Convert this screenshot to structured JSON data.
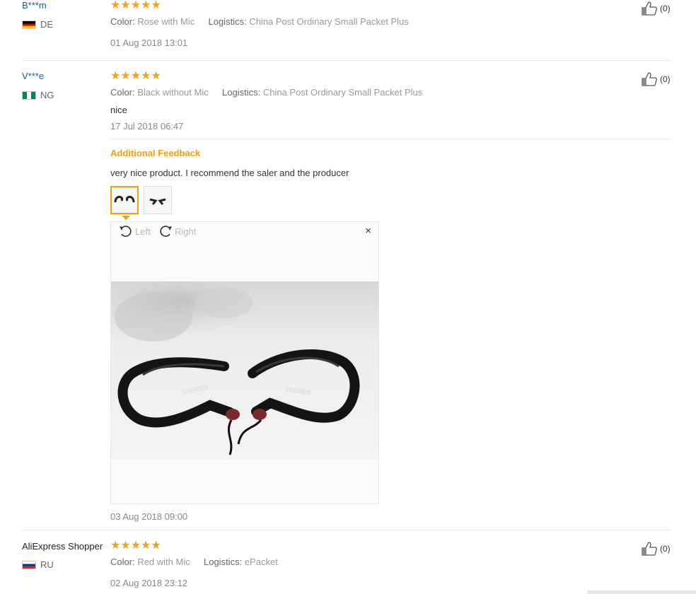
{
  "reviews": [
    {
      "user": "B***m",
      "country": "DE",
      "stars": "★★★★★",
      "color_label": "Color:",
      "color_value": "Rose with Mic",
      "logistics_label": "Logistics:",
      "logistics_value": "China Post Ordinary Small Packet Plus",
      "date": "01 Aug 2018 13:01",
      "helpful": "(0)"
    },
    {
      "user": "V***e",
      "country": "NG",
      "stars": "★★★★★",
      "color_label": "Color:",
      "color_value": "Black without Mic",
      "logistics_label": "Logistics:",
      "logistics_value": "China Post Ordinary Small Packet Plus",
      "text": "nice",
      "date": "17 Jul 2018 06:47",
      "helpful": "(0)",
      "additional": {
        "heading": "Additional Feedback",
        "text": "very nice product. I recommend the saler and the producer",
        "rotate_left": "Left",
        "rotate_right": "Right",
        "close": "×",
        "date": "03 Aug 2018 09:00",
        "photo_text_left": "STEREO",
        "photo_text_right": "STEREO"
      }
    },
    {
      "user": "AliExpress Shopper",
      "country": "RU",
      "stars": "★★★★★",
      "color_label": "Color:",
      "color_value": "Red with Mic",
      "logistics_label": "Logistics:",
      "logistics_value": "ePacket",
      "date": "02 Aug 2018 23:12",
      "helpful": "(0)"
    }
  ],
  "colors": {
    "accent": "#f59d0a",
    "star": "#f7a117",
    "username": "#1a5ab5"
  }
}
